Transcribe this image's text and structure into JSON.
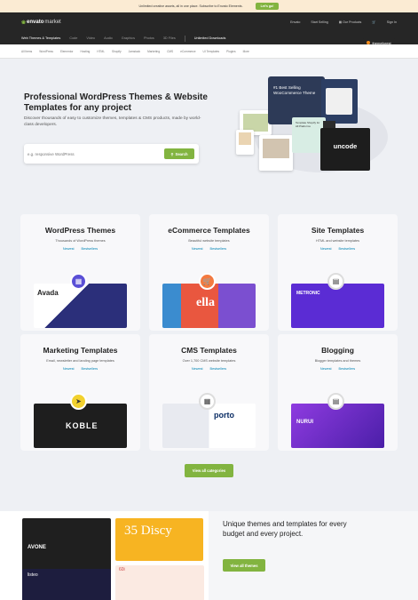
{
  "promo": {
    "text": "Unlimited creative assets, all in one place. Subscribe to Envato Elements.",
    "button": "Let's go!"
  },
  "header": {
    "logo_brand": "envato",
    "logo_suffix": "market",
    "links": [
      "Envato",
      "Start Selling",
      "Our Products",
      "Sign In"
    ]
  },
  "nav": {
    "items": [
      "Web Themes & Templates",
      "Code",
      "Video",
      "Audio",
      "Graphics",
      "Photos",
      "3D Files"
    ],
    "unlimited": "Unlimited Downloads",
    "badge": "themeforest"
  },
  "subnav": [
    "All Items",
    "WordPress",
    "Elementor",
    "Hosting",
    "HTML",
    "Shopify",
    "Jamstack",
    "Marketing",
    "CMS",
    "eCommerce",
    "UI Templates",
    "Plugins",
    "More"
  ],
  "hero": {
    "title": "Professional WordPress Themes & Website Templates for any project",
    "description": "Discover thousands of easy to customize themes, templates & CMS products, made by world-class developers.",
    "search_placeholder": "e.g. responsive WordPress",
    "search_button": "Search",
    "collage_text_1": "#1 Best Selling WooCommerce Theme",
    "collage_text_2": "Template Shopify for All Platforms",
    "collage_brand": "uncode"
  },
  "categories": [
    {
      "title": "WordPress Themes",
      "desc": "Thousands of WordPress themes",
      "newest": "Newest",
      "bestsellers": "Bestsellers",
      "shot_label": "Avada",
      "accent": "#3b3b8f"
    },
    {
      "title": "eCommerce Templates",
      "desc": "Beautiful website templates",
      "newest": "Newest",
      "bestsellers": "Bestsellers",
      "shot_label": "ella",
      "accent": "#f47a3f"
    },
    {
      "title": "Site Templates",
      "desc": "HTML and website templates",
      "newest": "Newest",
      "bestsellers": "Bestsellers",
      "shot_label": "METRONIC",
      "accent": "#6a2fe0"
    },
    {
      "title": "Marketing Templates",
      "desc": "Email, newsletter and landing page templates",
      "newest": "Newest",
      "bestsellers": "Bestsellers",
      "shot_label": "KOBLE",
      "accent": "#1e1e1e"
    },
    {
      "title": "CMS Templates",
      "desc": "Over 1,700 CMS website templates",
      "newest": "Newest",
      "bestsellers": "Bestsellers",
      "shot_label": "porto",
      "accent": "#0a2c64"
    },
    {
      "title": "Blogging",
      "desc": "Blogger templates and themes",
      "newest": "Newest",
      "bestsellers": "Bestsellers",
      "shot_label": "NURUI",
      "accent": "#7a2ec8"
    }
  ],
  "view_all_categories": "View all categories",
  "bottom": {
    "title": "Unique themes and templates for every budget and every project.",
    "button": "View all themes",
    "promo_1": "AVONE",
    "promo_2": "35 Discy",
    "promo_3": "listeo",
    "promo_4": "60i"
  }
}
